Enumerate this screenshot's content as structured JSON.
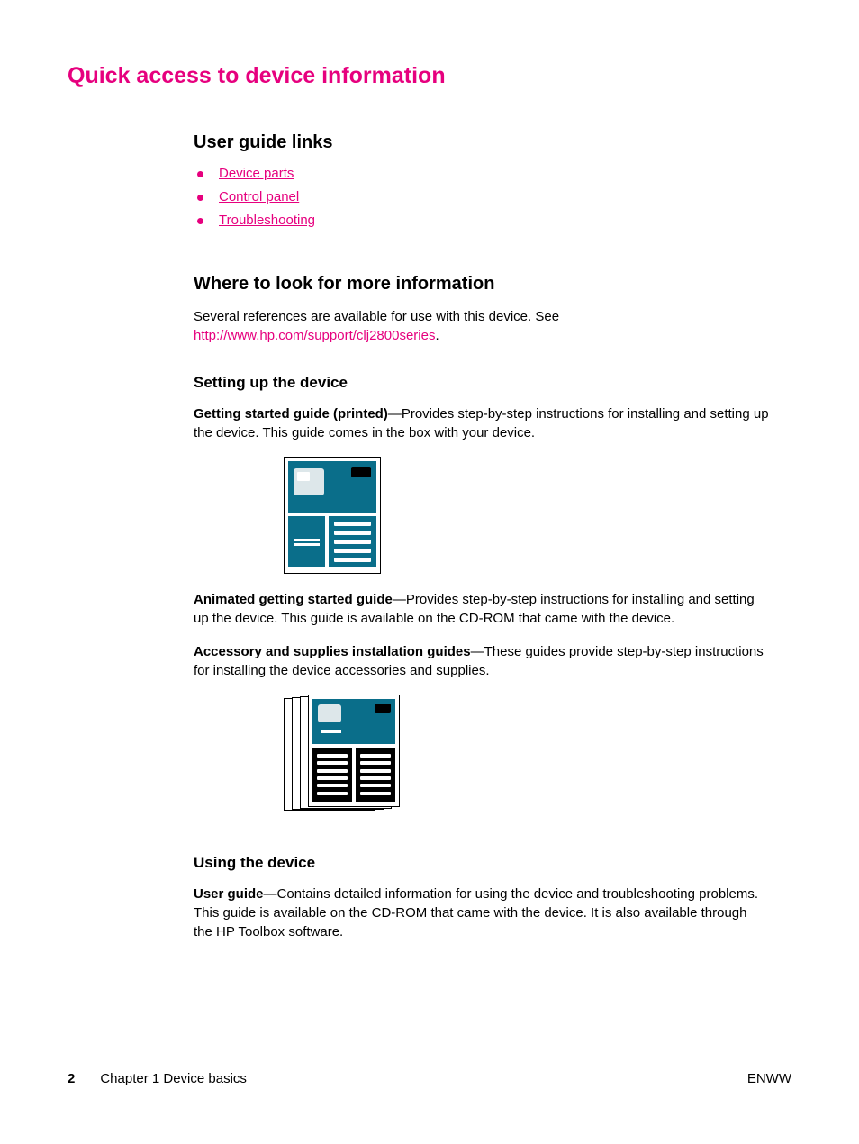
{
  "title": "Quick access to device information",
  "sections": {
    "user_guide_links": {
      "heading": "User guide links",
      "items": [
        "Device parts",
        "Control panel",
        "Troubleshooting"
      ]
    },
    "where": {
      "heading": "Where to look for more information",
      "intro_prefix": "Several references are available for use with this device. See ",
      "intro_link": "http://www.hp.com/support/clj2800series",
      "intro_suffix": ".",
      "setting_up": {
        "heading": "Setting up the device",
        "p1_bold": "Getting started guide (printed)",
        "p1_rest": "—Provides step-by-step instructions for installing and setting up the device. This guide comes in the box with your device.",
        "p2_bold": "Animated getting started guide",
        "p2_rest": "—Provides step-by-step instructions for installing and setting up the device. This guide is available on the CD-ROM that came with the device.",
        "p3_bold": "Accessory and supplies installation guides",
        "p3_rest": "—These guides provide step-by-step instructions for installing the device accessories and supplies."
      },
      "using": {
        "heading": "Using the device",
        "p1_bold": "User guide",
        "p1_rest": "—Contains detailed information for using the device and troubleshooting problems. This guide is available on the CD-ROM that came with the device. It is also available through the HP Toolbox software."
      }
    }
  },
  "footer": {
    "page_number": "2",
    "chapter": "Chapter 1  Device basics",
    "right": "ENWW"
  }
}
